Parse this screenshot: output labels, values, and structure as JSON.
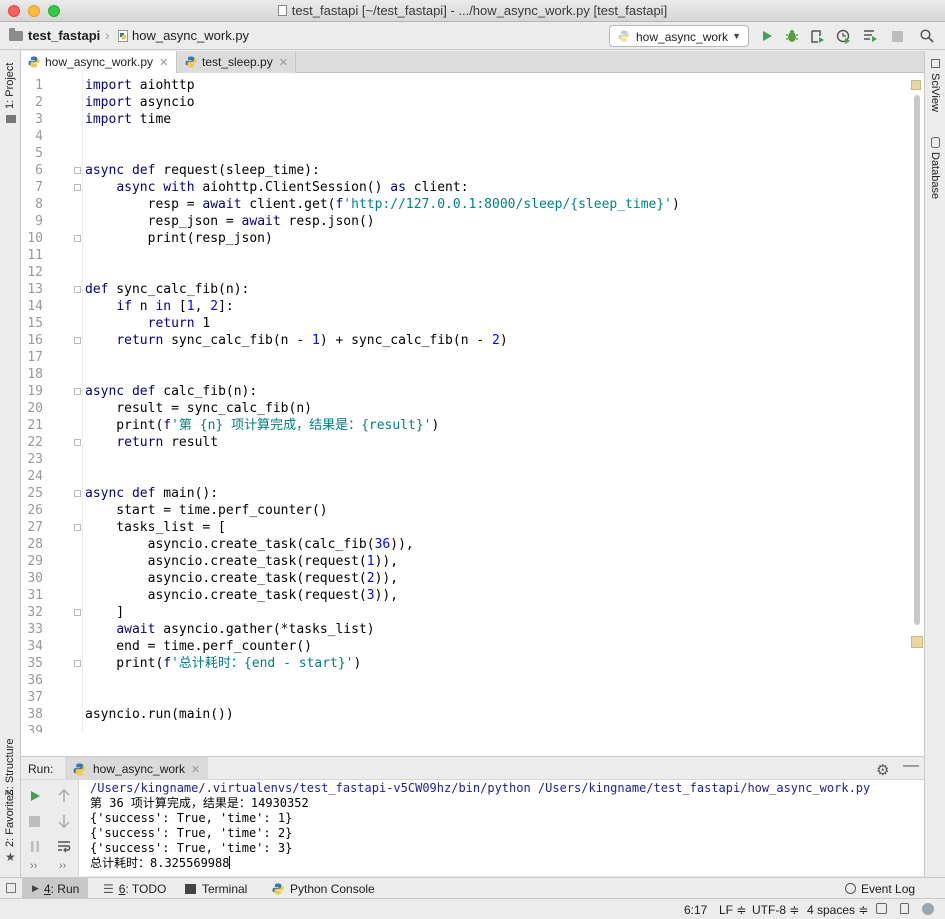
{
  "window": {
    "title": "test_fastapi [~/test_fastapi] - .../how_async_work.py [test_fastapi]"
  },
  "nav": {
    "project": "test_fastapi",
    "file": "how_async_work.py",
    "run_config": "how_async_work"
  },
  "left_strip": {
    "project": "1: Project",
    "structure": "Z: Structure",
    "favorites": "2: Favorites"
  },
  "right_strip": {
    "sciview": "SciView",
    "database": "Database"
  },
  "tabs": [
    {
      "label": "how_async_work.py",
      "active": true
    },
    {
      "label": "test_sleep.py",
      "active": false
    }
  ],
  "editor": {
    "lines": [
      {
        "n": "1",
        "text": "import aiohttp"
      },
      {
        "n": "2",
        "text": "import asyncio"
      },
      {
        "n": "3",
        "text": "import time"
      },
      {
        "n": "4",
        "text": ""
      },
      {
        "n": "5",
        "text": ""
      },
      {
        "n": "6",
        "text": "async def request(sleep_time):"
      },
      {
        "n": "7",
        "text": "    async with aiohttp.ClientSession() as client:"
      },
      {
        "n": "8",
        "text": "        resp = await client.get(f'http://127.0.0.1:8000/sleep/{sleep_time}')"
      },
      {
        "n": "9",
        "text": "        resp_json = await resp.json()"
      },
      {
        "n": "10",
        "text": "        print(resp_json)"
      },
      {
        "n": "11",
        "text": ""
      },
      {
        "n": "12",
        "text": ""
      },
      {
        "n": "13",
        "text": "def sync_calc_fib(n):"
      },
      {
        "n": "14",
        "text": "    if n in [1, 2]:"
      },
      {
        "n": "15",
        "text": "        return 1"
      },
      {
        "n": "16",
        "text": "    return sync_calc_fib(n - 1) + sync_calc_fib(n - 2)"
      },
      {
        "n": "17",
        "text": ""
      },
      {
        "n": "18",
        "text": ""
      },
      {
        "n": "19",
        "text": "async def calc_fib(n):"
      },
      {
        "n": "20",
        "text": "    result = sync_calc_fib(n)"
      },
      {
        "n": "21",
        "text": "    print(f'第 {n} 项计算完成，结果是：{result}')"
      },
      {
        "n": "22",
        "text": "    return result"
      },
      {
        "n": "23",
        "text": ""
      },
      {
        "n": "24",
        "text": ""
      },
      {
        "n": "25",
        "text": "async def main():"
      },
      {
        "n": "26",
        "text": "    start = time.perf_counter()"
      },
      {
        "n": "27",
        "text": "    tasks_list = ["
      },
      {
        "n": "28",
        "text": "        asyncio.create_task(calc_fib(36)),"
      },
      {
        "n": "29",
        "text": "        asyncio.create_task(request(1)),"
      },
      {
        "n": "30",
        "text": "        asyncio.create_task(request(2)),"
      },
      {
        "n": "31",
        "text": "        asyncio.create_task(request(3)),"
      },
      {
        "n": "32",
        "text": "    ]"
      },
      {
        "n": "33",
        "text": "    await asyncio.gather(*tasks_list)"
      },
      {
        "n": "34",
        "text": "    end = time.perf_counter()"
      },
      {
        "n": "35",
        "text": "    print(f'总计耗时：{end - start}')"
      },
      {
        "n": "36",
        "text": ""
      },
      {
        "n": "37",
        "text": ""
      },
      {
        "n": "38",
        "text": "asyncio.run(main())"
      },
      {
        "n": "39",
        "text": ""
      }
    ]
  },
  "run": {
    "label": "Run:",
    "tab": "how_async_work",
    "output": [
      "/Users/kingname/.virtualenvs/test_fastapi-v5CW09hz/bin/python /Users/kingname/test_fastapi/how_async_work.py",
      "第 36 项计算完成，结果是：14930352",
      "{'success': True, 'time': 1}",
      "{'success': True, 'time': 2}",
      "{'success': True, 'time': 3}",
      "总计耗时：8.325569988"
    ]
  },
  "bottom_tools": {
    "run_num": "4",
    "run": ": Run",
    "todo_num": "6",
    "todo": ": TODO",
    "terminal": "Terminal",
    "python_console": "Python Console",
    "event_log": "Event Log"
  },
  "status": {
    "position": "6:17",
    "line_sep": "LF ≑",
    "encoding": "UTF-8 ≑",
    "indent": "4 spaces ≑"
  },
  "colors": {
    "keyword": "#000080",
    "string": "#008080",
    "number": "#0000ff",
    "run_green": "#3fa34d",
    "current_line": "#fffae3"
  }
}
